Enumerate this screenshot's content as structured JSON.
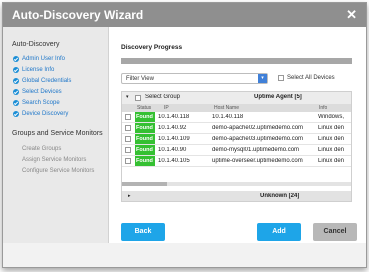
{
  "dialog": {
    "title": "Auto-Discovery Wizard",
    "close_glyph": "✕"
  },
  "sidebar": {
    "section1_title": "Auto-Discovery",
    "items": [
      {
        "label": "Admin User Info"
      },
      {
        "label": "License Info"
      },
      {
        "label": "Global Credentials"
      },
      {
        "label": "Select Devices"
      },
      {
        "label": "Search Scope"
      },
      {
        "label": "Device Discovery"
      }
    ],
    "section2_title": "Groups and Service Monitors",
    "group_items": [
      {
        "label": "Create Groups"
      },
      {
        "label": "Assign Service Monitors"
      },
      {
        "label": "Configure Service Monitors"
      }
    ]
  },
  "main": {
    "progress_label": "Discovery Progress",
    "filter_value": "Filter View",
    "select_all_label": "Select All Devices",
    "group_label": "Select Group",
    "group_name": "Uptime Agent [5]",
    "columns": {
      "status": "Status",
      "ip": "IP",
      "host": "Host Name",
      "info": "Info"
    },
    "rows": [
      {
        "status": "Found",
        "ip": "10.1.40.118",
        "host": "10.1.40.118",
        "info": "Windows,"
      },
      {
        "status": "Found",
        "ip": "10.1.40.92",
        "host": "demo-apache02.uptimedemo.com",
        "info": "Linux den"
      },
      {
        "status": "Found",
        "ip": "10.1.40.109",
        "host": "demo-apache03.uptimedemo.com",
        "info": "Linux den"
      },
      {
        "status": "Found",
        "ip": "10.1.40.90",
        "host": "demo-mysql01.uptimedemo.com",
        "info": "Linux den"
      },
      {
        "status": "Found",
        "ip": "10.1.40.105",
        "host": "uptime-overseer.uptimedemo.com",
        "info": "Linux den"
      }
    ],
    "unknown_label": "Unknown [24]"
  },
  "footer": {
    "back": "Back",
    "add": "Add",
    "cancel": "Cancel"
  },
  "colors": {
    "accent": "#1b8ed6",
    "button_blue": "#1ea5e8",
    "found_green": "#35c032",
    "cancel": "#b8b8b8"
  }
}
